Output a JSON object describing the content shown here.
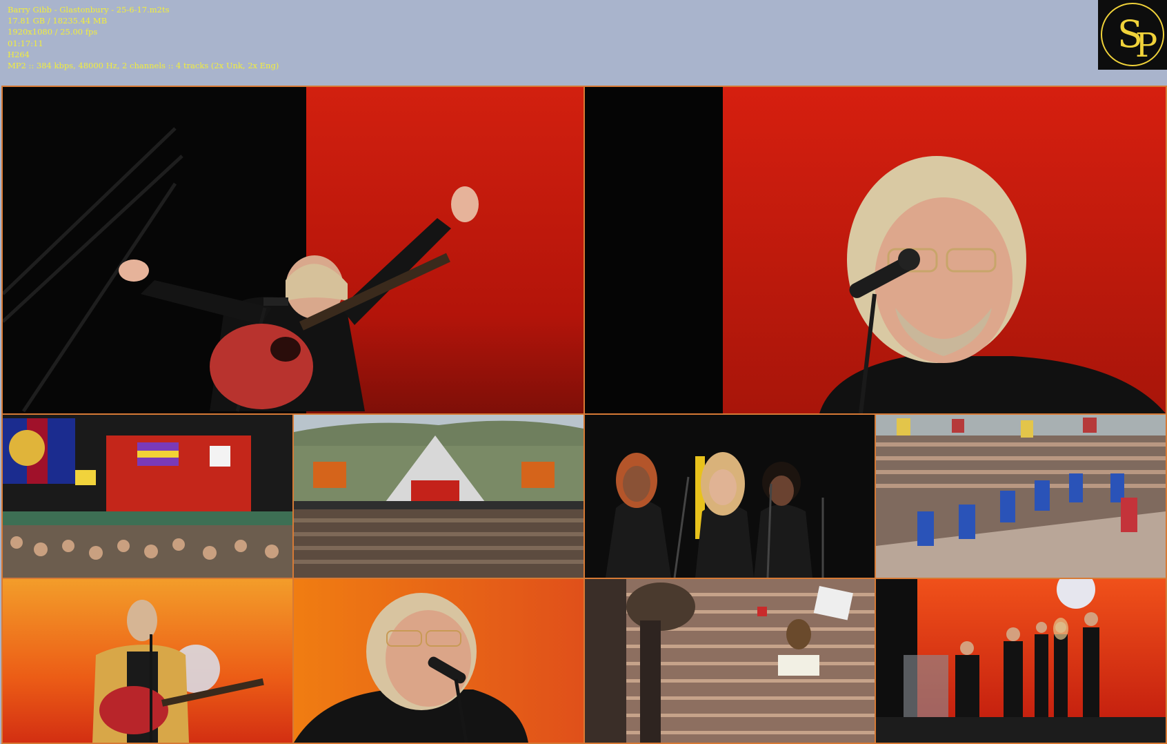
{
  "file_info": {
    "filename": "Barry Gibb - Glastonbury - 25-6-17.m2ts",
    "size": "17.81 GB / 18235.44 MB",
    "resolution": "1920x1080 / 25.00 fps",
    "duration": "01:17:11",
    "video_codec": "H264",
    "audio": "MP2 :: 384 kbps, 48000 Hz, 2 channels :: 4 tracks (2x Unk, 2x Eng)"
  },
  "logo": {
    "letters": "SP",
    "color": "#f0d23a",
    "background": "#0d0d0d"
  },
  "colors": {
    "background": "#a9b4cc",
    "info_text": "#f3ee3a",
    "thumb_border": "#d77a35",
    "stage_red": "#c41d10",
    "sunset_orange": "#f07a14"
  },
  "thumbnails": [
    "singer-arms-raised-with-guitar",
    "singer-closeup-at-microphone",
    "crowd-with-flags-facing-stage",
    "festival-pyramid-stage-wide-shot",
    "three-backing-singers",
    "crowd-and-security-stewards",
    "singer-gold-jacket-with-guitar",
    "singer-closeup-sunset-backdrop",
    "crowd-with-signs",
    "band-on-stage-sunset-backdrop"
  ]
}
